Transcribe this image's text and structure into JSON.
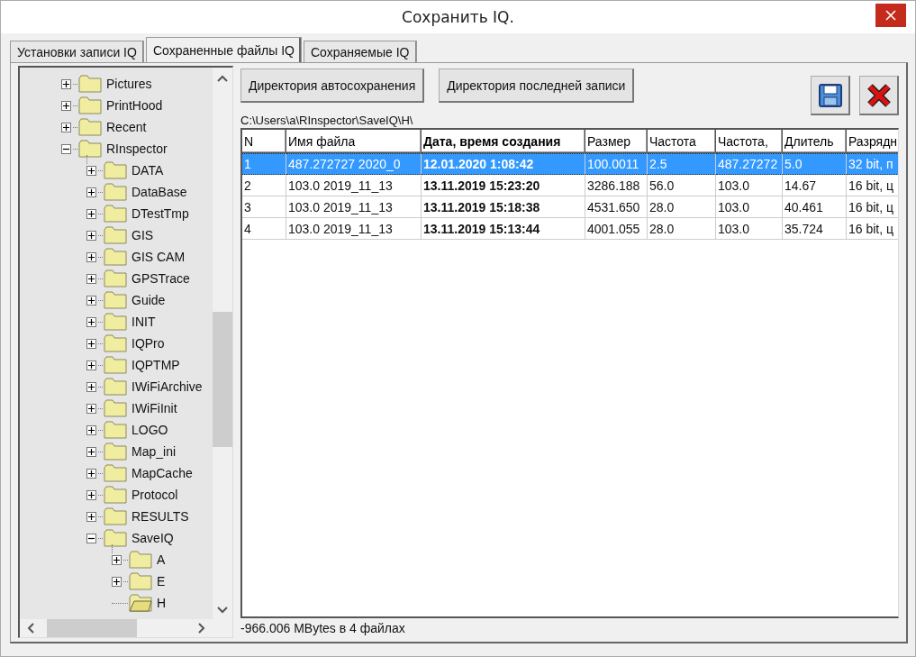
{
  "window": {
    "title": "Сохранить IQ."
  },
  "tabs": [
    {
      "label": "Установки записи IQ",
      "selected": false
    },
    {
      "label": "Сохраненные файлы IQ",
      "selected": true
    },
    {
      "label": "Сохраняемые IQ",
      "selected": false
    }
  ],
  "tree": [
    {
      "label": "Pictures",
      "expanded": false,
      "selected": false
    },
    {
      "label": "PrintHood",
      "expanded": false,
      "selected": false
    },
    {
      "label": "Recent",
      "expanded": false,
      "selected": false
    },
    {
      "label": "RInspector",
      "expanded": true,
      "selected": false,
      "children": [
        {
          "label": "DATA",
          "expanded": false,
          "selected": false
        },
        {
          "label": "DataBase",
          "expanded": false,
          "selected": false
        },
        {
          "label": "DTestTmp",
          "expanded": false,
          "selected": false
        },
        {
          "label": "GIS",
          "expanded": false,
          "selected": false
        },
        {
          "label": "GIS  CAM",
          "expanded": false,
          "selected": false
        },
        {
          "label": "GPSTrace",
          "expanded": false,
          "selected": false
        },
        {
          "label": "Guide",
          "expanded": false,
          "selected": false
        },
        {
          "label": "INIT",
          "expanded": false,
          "selected": false
        },
        {
          "label": "IQPro",
          "expanded": false,
          "selected": false
        },
        {
          "label": "IQPTMP",
          "expanded": false,
          "selected": false
        },
        {
          "label": "IWiFiArchive",
          "expanded": false,
          "selected": false
        },
        {
          "label": "IWiFiInit",
          "expanded": false,
          "selected": false
        },
        {
          "label": "LOGO",
          "expanded": false,
          "selected": false
        },
        {
          "label": "Map_ini",
          "expanded": false,
          "selected": false
        },
        {
          "label": "MapCache",
          "expanded": false,
          "selected": false
        },
        {
          "label": "Protocol",
          "expanded": false,
          "selected": false
        },
        {
          "label": "RESULTS",
          "expanded": false,
          "selected": false
        },
        {
          "label": "SaveIQ",
          "expanded": true,
          "selected": false,
          "children": [
            {
              "label": "A",
              "expanded": false,
              "selected": false
            },
            {
              "label": "E",
              "expanded": false,
              "selected": false
            },
            {
              "label": "H",
              "selected": true
            }
          ]
        }
      ]
    }
  ],
  "buttons": [
    "Директория автосохранения",
    "Директория последней записи"
  ],
  "path": "C:\\Users\\a\\RInspector\\SaveIQ\\H\\",
  "table": {
    "columns": [
      {
        "label": "N",
        "bold": false
      },
      {
        "label": "Имя файла",
        "bold": false
      },
      {
        "label": "Дата, время создания",
        "bold": true
      },
      {
        "label": "Размер",
        "bold": false
      },
      {
        "label": "Частота",
        "bold": false
      },
      {
        "label": "Частота,",
        "bold": false
      },
      {
        "label": "Длитель",
        "bold": false
      },
      {
        "label": "Разрядн",
        "bold": false
      }
    ],
    "rows": [
      {
        "selected": true,
        "cells": [
          "1",
          "487.272727 2020_0",
          "12.01.2020 1:08:42",
          "100.0011",
          "2.5",
          "487.27272",
          "5.0",
          "32 bit, п"
        ]
      },
      {
        "selected": false,
        "cells": [
          "2",
          "103.0 2019_11_13",
          "13.11.2019 15:23:20",
          "3286.188",
          "56.0",
          "103.0",
          "14.67",
          "16 bit, ц"
        ]
      },
      {
        "selected": false,
        "cells": [
          "3",
          "103.0 2019_11_13",
          "13.11.2019 15:18:38",
          "4531.650",
          "28.0",
          "103.0",
          "40.461",
          "16 bit, ц"
        ]
      },
      {
        "selected": false,
        "cells": [
          "4",
          "103.0 2019_11_13",
          "13.11.2019 15:13:44",
          "4001.055",
          "28.0",
          "103.0",
          "35.724",
          "16 bit, ц"
        ]
      }
    ]
  },
  "status": "-966.006 MBytes в 4 файлах"
}
